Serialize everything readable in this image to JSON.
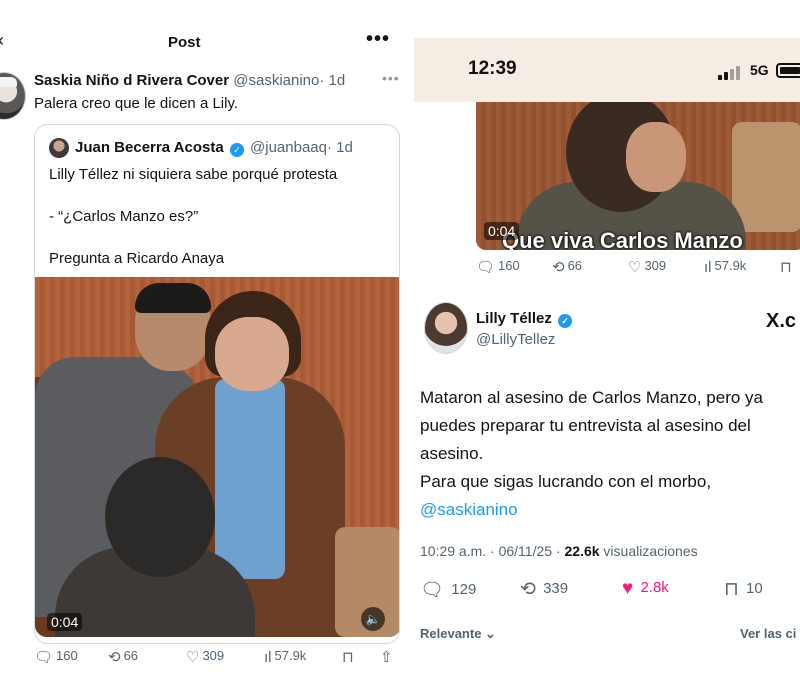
{
  "left": {
    "header": {
      "title": "Post",
      "more": "•••"
    },
    "tweet": {
      "name": "Saskia Niño d Rivera Cover",
      "handle": "@saskianino",
      "time": "· 1d",
      "text": "Palera creo que le dicen a Lily."
    },
    "quote": {
      "name": "Juan Becerra Acosta",
      "handle": "@juanbaaq",
      "time": "· 1d",
      "lines": [
        "Lilly Téllez ni siquiera sabe porqué protesta",
        "- “¿Carlos Manzo es?”",
        "Pregunta a Ricardo Anaya"
      ],
      "video_time": "0:04"
    },
    "actions": {
      "replies": "160",
      "reposts": "66",
      "likes": "309",
      "views": "57.9k"
    }
  },
  "right": {
    "status": {
      "time": "12:39",
      "network": "5G"
    },
    "video": {
      "time": "0:04",
      "caption": "Que viva Carlos Manzo"
    },
    "actions_top": {
      "replies": "160",
      "reposts": "66",
      "likes": "309",
      "views": "57.9k"
    },
    "post": {
      "name": "Lilly Téllez",
      "handle": "@LillyTellez",
      "brand": "X.c",
      "text_1": "Mataron al asesino de Carlos Manzo, pero ya puedes preparar tu entrevista al asesino del asesino.",
      "text_2": "Para que sigas lucrando con el morbo,",
      "mention": "@saskianino",
      "timestamp": "10:29 a.m. · 06/11/25 · ",
      "views_count": "22.6k",
      "views_label": " visualizaciones"
    },
    "actions_bottom": {
      "replies": "129",
      "reposts": "339",
      "likes": "2.8k",
      "bookmarks": "10"
    },
    "tabs": {
      "relevant": "Relevante ⌄",
      "see_quotes": "Ver las ci"
    }
  },
  "colors": {
    "accent": "#1d9bf0",
    "like": "#f91880",
    "muted": "#536471"
  }
}
